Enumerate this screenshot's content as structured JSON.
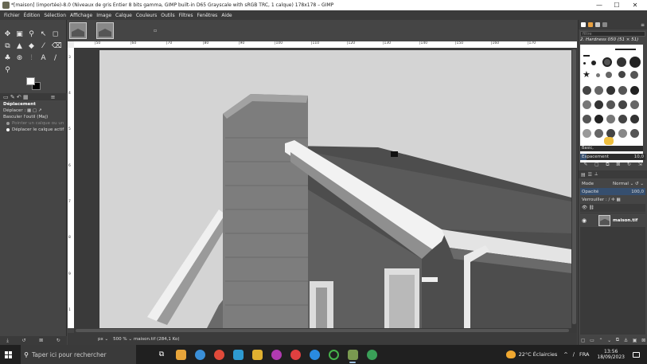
{
  "window": {
    "title": "*[maison] (importée)-8.0 (Niveaux de gris Entier 8 bits gamma, GIMP built-in D65 Grayscale with sRGB TRC, 1 calque) 178x178 – GIMP",
    "minimize": "—",
    "maximize": "☐",
    "close": "✕"
  },
  "menu": [
    "Fichier",
    "Édition",
    "Sélection",
    "Affichage",
    "Image",
    "Calque",
    "Couleurs",
    "Outils",
    "Filtres",
    "Fenêtres",
    "Aide"
  ],
  "tool_options": {
    "title": "Déplacement",
    "move_label": "Déplacer :",
    "toggle_label": "Basculer l'outil (Maj)",
    "option1": "Pointer un calque ou un",
    "option2": "Déplacer le calque actif"
  },
  "ruler": {
    "top": [
      "|50",
      "|60",
      "|70",
      "|80",
      "|90",
      "|100",
      "|110",
      "|120",
      "|130",
      "|140",
      "|150",
      "|160",
      "|170"
    ],
    "left": [
      "3",
      "4",
      "5",
      "6",
      "7",
      "8",
      "9",
      "1"
    ]
  },
  "statusbar": {
    "unit": "px",
    "zoom": "500 %",
    "file": "maison.tif (284,1 Ko)"
  },
  "brushes": {
    "filter_placeholder": "filtre",
    "name": "2. Hardness 050 (51 × 51)",
    "tag": "Basic,",
    "spacing_label": "Espacement",
    "spacing_value": "10,0",
    "spacing_fraction": 0.1
  },
  "layers": {
    "mode_label": "Mode",
    "mode_value": "Normal",
    "opacity_label": "Opacité",
    "opacity_value": "100,0",
    "opacity_fraction": 1.0,
    "lock_label": "Verrouiller :",
    "layer_name": "maison.tif"
  },
  "taskbar": {
    "search_placeholder": "Taper ici pour rechercher",
    "weather": "22°C  Éclaircies",
    "lang": "FRA",
    "time": "13:56",
    "date": "18/09/2023",
    "app_colors": [
      "#e8a53a",
      "#3a8fd8",
      "#e04a3a",
      "#2e9ad1",
      "#e0b030",
      "#b03ab0",
      "#e04040",
      "#2a8ae0",
      "#46b34b",
      "#7a9a50",
      "#3aa058"
    ]
  }
}
